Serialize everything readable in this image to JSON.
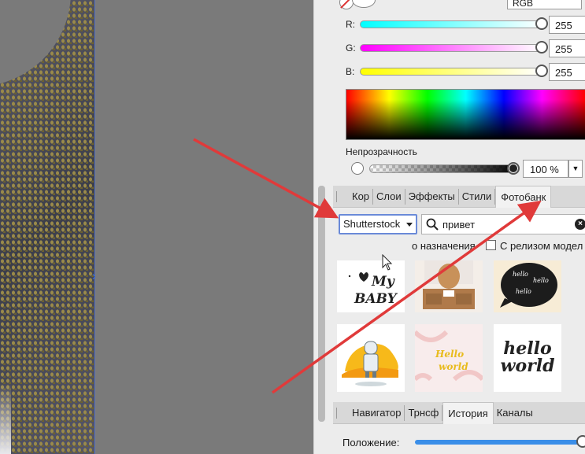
{
  "color_panel": {
    "color_mode": "RGB",
    "channels": [
      {
        "label": "R:",
        "value": "255"
      },
      {
        "label": "G:",
        "value": "255"
      },
      {
        "label": "B:",
        "value": "255"
      }
    ],
    "opacity_label": "Непрозрачность",
    "opacity_value": "100 %"
  },
  "top_tabs": [
    "Кор",
    "Слои",
    "Эффекты",
    "Стили",
    "Фотобанк"
  ],
  "photobank": {
    "source": "Shutterstock",
    "search_value": "привет",
    "clear_symbol": "×",
    "filter_purpose": "о назначения",
    "filter_release": "С релизом модел",
    "thumbnails": [
      {
        "text": "My BABY"
      },
      {
        "text": ""
      },
      {
        "text": "hello hello hello"
      },
      {
        "text": ""
      },
      {
        "text": "hello world"
      },
      {
        "text": "hello world"
      }
    ]
  },
  "bottom_tabs": [
    "Навигатор",
    "Трнсф",
    "История",
    "Каналы"
  ],
  "navigator": {
    "position_label": "Положение:"
  },
  "colors": {
    "arrow": "#e03a3a",
    "accent": "#3a8ee8"
  }
}
